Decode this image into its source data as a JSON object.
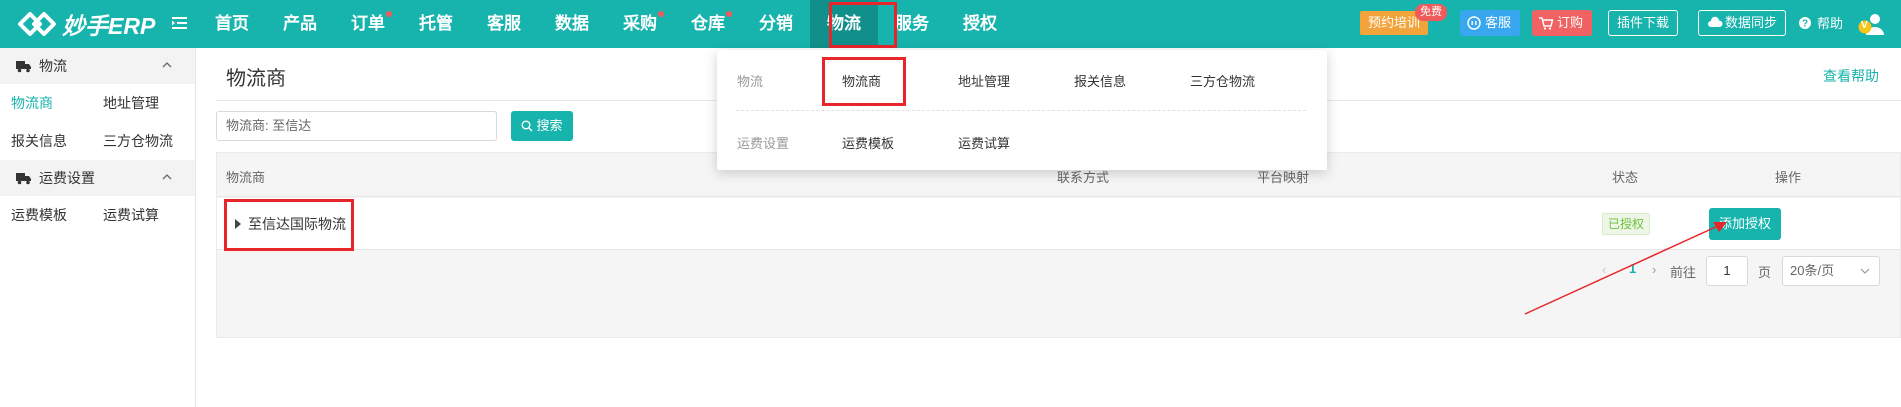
{
  "app": {
    "logo_text": "妙手ERP"
  },
  "nav": {
    "items": [
      {
        "label": "首页",
        "dot": false
      },
      {
        "label": "产品",
        "dot": false
      },
      {
        "label": "订单",
        "dot": true
      },
      {
        "label": "托管",
        "dot": false
      },
      {
        "label": "客服",
        "dot": false
      },
      {
        "label": "数据",
        "dot": false
      },
      {
        "label": "采购",
        "dot": true
      },
      {
        "label": "仓库",
        "dot": true
      },
      {
        "label": "分销",
        "dot": false
      },
      {
        "label": "物流",
        "dot": false,
        "active": true
      },
      {
        "label": "服务",
        "dot": false
      },
      {
        "label": "授权",
        "dot": false
      }
    ]
  },
  "toolbar": {
    "training_label": "预约培训",
    "free_badge": "免费",
    "cs_label": "客服",
    "order_label": "订购",
    "plugin_label": "插件下载",
    "sync_label": "数据同步",
    "help_label": "帮助",
    "avatar_letter": "V"
  },
  "sidebar": {
    "groups": [
      {
        "label": "物流",
        "items": [
          "物流商",
          "地址管理",
          "报关信息",
          "三方仓物流"
        ],
        "active_index": 0
      },
      {
        "label": "运费设置",
        "items": [
          "运费模板",
          "运费试算"
        ]
      }
    ]
  },
  "page": {
    "title": "物流商",
    "view_help": "查看帮助",
    "search_value": "物流商:   至信达",
    "search_button": "搜索"
  },
  "table": {
    "headers": {
      "name": "物流商",
      "contact": "联系方式",
      "platform": "平台映射",
      "status": "状态",
      "actions": "操作"
    },
    "rows": [
      {
        "name": "至信达国际物流",
        "status": "已授权",
        "action": "添加授权"
      }
    ]
  },
  "pagination": {
    "current_page": "1",
    "goto_label": "前往",
    "goto_value": "1",
    "page_unit": "页",
    "page_size": "20条/页"
  },
  "dropdown": {
    "groups": [
      {
        "label": "物流",
        "items": [
          "物流商",
          "地址管理",
          "报关信息",
          "三方仓物流"
        ]
      },
      {
        "label": "运费设置",
        "items": [
          "运费模板",
          "运费试算"
        ]
      }
    ]
  },
  "colors": {
    "brand": "#17b3ad",
    "highlight": "#e8252b",
    "status_green": "#6fbf3b"
  }
}
